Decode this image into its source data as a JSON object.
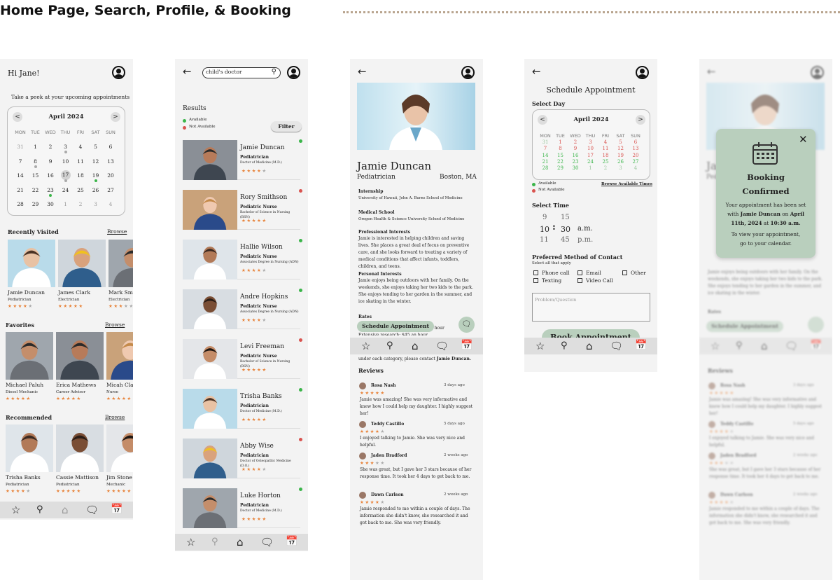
{
  "page": {
    "title": "Home Page, Search, Profile, & Booking"
  },
  "colors": {
    "accent": "#b9cfbd",
    "available": "#3bb54a",
    "not_available": "#d9534f",
    "star": "#e8833a"
  },
  "nav": {
    "icons": [
      "star-icon",
      "search-icon",
      "home-icon",
      "chat-icon",
      "calendar-icon"
    ]
  },
  "home": {
    "greeting": "Hi Jane!",
    "subtitle": "Take a peek at your upcoming appointments",
    "calendar": {
      "month": "April 2024",
      "prev": "<",
      "next": ">",
      "weekdays": [
        "MON",
        "TUE",
        "WED",
        "THU",
        "FRI",
        "SAT",
        "SUN"
      ],
      "weeks": [
        [
          "31",
          "1",
          "2",
          "3",
          "4",
          "5",
          "6"
        ],
        [
          "7",
          "8",
          "9",
          "10",
          "11",
          "12",
          "13"
        ],
        [
          "14",
          "15",
          "16",
          "17",
          "18",
          "19",
          "20"
        ],
        [
          "21",
          "22",
          "23",
          "24",
          "25",
          "26",
          "27"
        ],
        [
          "28",
          "29",
          "30",
          "1",
          "2",
          "3",
          "4"
        ]
      ]
    },
    "recent": {
      "title": "Recently Visited",
      "browse": "Browse",
      "items": [
        {
          "name": "Jamie Duncan",
          "role": "Pediatrician",
          "rating": 4
        },
        {
          "name": "James Clark",
          "role": "Electrician",
          "rating": 5
        },
        {
          "name": "Mark Smit",
          "role": "Electrician",
          "rating": 3
        }
      ]
    },
    "favorites": {
      "title": "Favorites",
      "browse": "Browse",
      "items": [
        {
          "name": "Michael Paluh",
          "role": "Diesel Mechanic",
          "rating": 5
        },
        {
          "name": "Erica Mathews",
          "role": "Career Advisor",
          "rating": 5
        },
        {
          "name": "Micah Cla",
          "role": "Nurse",
          "rating": 5
        }
      ]
    },
    "recommended": {
      "title": "Recommended",
      "browse": "Browse",
      "items": [
        {
          "name": "Trisha Banks",
          "role": "Pediatrician",
          "rating": 4
        },
        {
          "name": "Cassie Mattison",
          "role": "Pediatrician",
          "rating": 5
        },
        {
          "name": "Jim Stone",
          "role": "Mechanic",
          "rating": 5
        }
      ]
    }
  },
  "search": {
    "query": "child's doctor",
    "results_title": "Results",
    "legend_available": "Available",
    "legend_not_available": "Not Available",
    "filter": "Filter",
    "results": [
      {
        "name": "Jamie Duncan",
        "role": "Pediatrician",
        "degree": "Doctor of Medicine (M.D.)",
        "rating": 4,
        "available": true
      },
      {
        "name": "Rory Smithson",
        "role": "Pediatric Nurse",
        "degree": "Bachelor of Science in Nursing (BSN)",
        "rating": 5,
        "available": false
      },
      {
        "name": "Hallie Wilson",
        "role": "Pediatric Nurse",
        "degree": "Associates Degree in Nursing (ADN)",
        "rating": 4,
        "available": true
      },
      {
        "name": "Andre Hopkins",
        "role": "Pediatric Nurse",
        "degree": "Associates Degree in Nursing (ADN)",
        "rating": 4,
        "available": true
      },
      {
        "name": "Levi Freeman",
        "role": "Pediatric Nurse",
        "degree": "Bachelor of Science in Nursing (BSN)",
        "rating": 5,
        "available": false
      },
      {
        "name": "Trisha Banks",
        "role": "Pediatrician",
        "degree": "Doctor of Medicine (M.D.)",
        "rating": 5,
        "available": true
      },
      {
        "name": "Abby Wise",
        "role": "Pediatrician",
        "degree": "Doctor of Osteopathic Medicine (D.O.)",
        "rating": 4,
        "available": false
      },
      {
        "name": "Luke Horton",
        "role": "Pediatrician",
        "degree": "Doctor of Medicine (M.D.)",
        "rating": 5,
        "available": true
      }
    ]
  },
  "profile": {
    "name": "Jamie Duncan",
    "role": "Pediatrician",
    "location": "Boston, MA",
    "internship_label": "Internship",
    "internship": "University of Hawaii, John A. Burns School of Medicine",
    "medical_label": "Medical School",
    "medical": "Oregon Health & Science University School of Medicine",
    "prof_label": "Professional Interests",
    "prof": "Jamie is interested in helping children and saving lives. She places a great deal of focus on preventive care, and she looks forward to treating a variety of medical conditions that affect infants, toddlers, children, and teens.",
    "personal_label": "Personal Interests",
    "personal": "Jamie enjoys being outdoors with her family. On the weekends, she enjoys taking her two kids to the park. She enjoys tending to her garden in the summer, and ice skating in the winter.",
    "rates_label": "Rates",
    "rates_1": "Specialized medical advice: $40 an hour",
    "rates_2": "Extensive research: $45 an hour",
    "rates_3": "under each category, please contact",
    "rates_3b": "Jamie Duncan.",
    "schedule_btn": "Schedule Appointment",
    "reviews_title": "Reviews",
    "reviews": [
      {
        "name": "Rosa Nash",
        "time": "3 days ago",
        "rating": 5,
        "text": "Jamie was amazing! She was very informative and knew how I could help my daughter. I highly suggest her!"
      },
      {
        "name": "Teddy Castillo",
        "time": "5 days ago",
        "rating": 4,
        "text": "I enjoyed talking to Jamie. She was very nice and helpful."
      },
      {
        "name": "Jaden Bradford",
        "time": "2 weeks ago",
        "rating": 3,
        "text": "She was great, but I gave her 3 stars because of her response time. It took her 4 days to get back to me."
      },
      {
        "name": "Dawn Carlson",
        "time": "2 weeks ago",
        "rating": 4,
        "text": "Jamie responded to me within a couple of days. The information she didn't know, she researched it and got back to me. She was very friendly."
      }
    ]
  },
  "schedule": {
    "title": "Schedule Appointment",
    "select_day": "Select Day",
    "month": "April 2024",
    "weekdays": [
      "MON",
      "TUE",
      "WED",
      "THU",
      "FRI",
      "SAT",
      "SUN"
    ],
    "weeks": [
      [
        "31",
        "1",
        "2",
        "3",
        "4",
        "5",
        "6"
      ],
      [
        "7",
        "8",
        "9",
        "10",
        "11",
        "12",
        "13"
      ],
      [
        "14",
        "15",
        "16",
        "17",
        "18",
        "19",
        "20"
      ],
      [
        "21",
        "22",
        "23",
        "24",
        "25",
        "26",
        "27"
      ],
      [
        "28",
        "29",
        "30",
        "1",
        "2",
        "3",
        "4"
      ]
    ],
    "legend_available": "Available",
    "legend_not_available": "Not Available",
    "browse_times": "Browse Available Times",
    "select_time": "Select Time",
    "hours": [
      "9",
      "10",
      "11"
    ],
    "minutes": [
      "15",
      "30",
      "45"
    ],
    "ampm": [
      "a.m.",
      "p.m."
    ],
    "colon": ":",
    "contact_title": "Preferred Method of Contact",
    "contact_sub": "Select all that apply",
    "options": [
      "Phone call",
      "Email",
      "Other",
      "Texting",
      "Video Call"
    ],
    "problem_placeholder": "Problem/Question",
    "book_btn": "Book Appointment"
  },
  "confirm": {
    "title_1": "Booking",
    "title_2": "Confirmed",
    "msg_1": "Your appointment has been set",
    "msg_2a": "with",
    "msg_2b": "Jamie Duncan",
    "msg_2c": "on",
    "msg_2d": "April",
    "msg_3": "11th, 2024",
    "msg_3b": "at",
    "msg_3c": "10:30 a.m.",
    "msg_4": "To view your appointment,",
    "msg_5": "go to your calendar."
  }
}
